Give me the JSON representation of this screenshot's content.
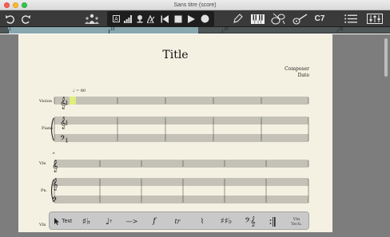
{
  "window": {
    "title": "Sans titre (score)"
  },
  "toolbar": {
    "instrument_label": "C7"
  },
  "ruler": {
    "labels": [
      "1",
      "10",
      "18",
      "26"
    ]
  },
  "score": {
    "title": "Title",
    "composer": "Composer",
    "date": "Date",
    "tempo": "♩ = 80",
    "system1": {
      "top_instrument": "Violon",
      "piano": "Piano"
    },
    "system2": {
      "bar_number": "6",
      "top_instrument": "Vln",
      "piano": "Pn."
    },
    "system3": {
      "top_instrument": "Vln"
    }
  },
  "palette": {
    "text_label": "Text",
    "symbols": {
      "accidentals": "♯♭",
      "note_rest": "♩𝄾",
      "hairpin": "—>",
      "dynamic": "f",
      "ornament": "tr",
      "tremolo": "⌇",
      "key_sig": "♯♯♭",
      "clef": "𝄢𝄞"
    },
    "vln_label_1": "Vln",
    "vln_label_2": "Tech."
  }
}
